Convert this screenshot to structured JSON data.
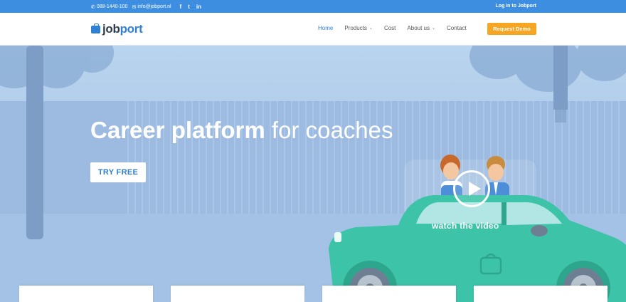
{
  "topbar": {
    "phone": "088-1440-100",
    "email": "info@jobport.nl",
    "social": [
      "f",
      "t",
      "in"
    ],
    "login": "Log in to Jobport"
  },
  "header": {
    "logo_part1": "job",
    "logo_part2": "port",
    "nav": [
      {
        "label": "Home",
        "active": true,
        "dropdown": false
      },
      {
        "label": "Products",
        "active": false,
        "dropdown": true
      },
      {
        "label": "Cost",
        "active": false,
        "dropdown": false
      },
      {
        "label": "About us",
        "active": false,
        "dropdown": true
      },
      {
        "label": "Contact",
        "active": false,
        "dropdown": false
      }
    ],
    "cta": "Request Demo",
    "dropdown_glyph": "⌄"
  },
  "hero": {
    "headline_bold": "Career platform",
    "headline_rest": " for coaches",
    "try_button": "TRY FREE",
    "video_label": "watch the video"
  },
  "colors": {
    "topbar": "#3d8ee0",
    "brand_blue": "#2f7fd3",
    "cta_orange": "#f6a623",
    "car_teal": "#3cc3a8"
  }
}
